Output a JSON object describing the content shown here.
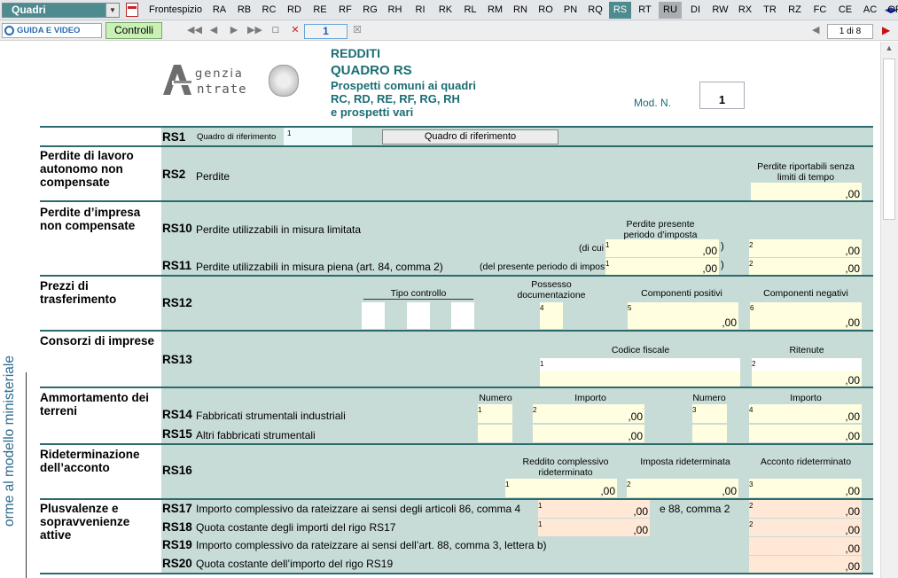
{
  "toolbar": {
    "combo_value": "Quadri",
    "frontespizio": "Frontespizio",
    "tabs": [
      "RA",
      "RB",
      "RC",
      "RD",
      "RE",
      "RF",
      "RG",
      "RH",
      "RI",
      "RK",
      "RL",
      "RM",
      "RN",
      "RO",
      "PN",
      "RQ",
      "RS",
      "RT",
      "RU",
      "DI",
      "RW",
      "RX",
      "TR",
      "RZ",
      "FC",
      "CE",
      "AC",
      "OF"
    ],
    "selected_tab": "RS",
    "guida_label": "GUIDA E VIDEO",
    "controlli_label": "Controlli",
    "page_number": "1",
    "page_of": "1 di 8"
  },
  "sidebar": {
    "vertical_text": "orme al modello ministeriale"
  },
  "header": {
    "agenzia": "genzia",
    "entrate": "ntrate",
    "title1": "REDDITI",
    "title2": "QUADRO RS",
    "subtitle1": "Prospetti comuni ai quadri",
    "subtitle2": "RC, RD, RE, RF, RG, RH",
    "subtitle3": "e prospetti vari",
    "mod_label": "Mod. N.",
    "mod_value": "1"
  },
  "rs1": {
    "code": "RS1",
    "label": "Quadro di riferimento",
    "button": "Quadro di riferimento"
  },
  "perdite_lavoro": {
    "title": "Perdite di lavoro autonomo non compensate",
    "rs2_code": "RS2",
    "rs2_label": "Perdite",
    "col_header": "Perdite riportabili senza limiti di tempo",
    "value": ",00"
  },
  "perdite_impresa": {
    "title": "Perdite d’impresa non compensate",
    "col_header": "Perdite presente periodo d’imposta",
    "rs10_code": "RS10",
    "rs10_label": "Perdite utilizzabili in misura limitata",
    "rs10_dicui": "(di cui",
    "rs11_code": "RS11",
    "rs11_label": "Perdite utilizzabili in misura piena (art. 84, comma 2)",
    "rs11_del": "(del presente periodo di imposta",
    "value": ",00",
    "close": ")"
  },
  "prezzi": {
    "title": "Prezzi di trasferimento",
    "code": "RS12",
    "tipo_controllo": "Tipo controllo",
    "possesso": "Possesso documentazione",
    "comp_pos": "Componenti positivi",
    "comp_neg": "Componenti negativi",
    "value": ",00"
  },
  "consorzi": {
    "title": "Consorzi di imprese",
    "code": "RS13",
    "codice_fiscale": "Codice fiscale",
    "ritenute": "Ritenute",
    "value": ",00"
  },
  "ammortamento": {
    "title": "Ammortamento dei terreni",
    "numero": "Numero",
    "importo": "Importo",
    "rs14_code": "RS14",
    "rs14_label": "Fabbricati strumentali industriali",
    "rs15_code": "RS15",
    "rs15_label": "Altri fabbricati strumentali",
    "value": ",00"
  },
  "rideterminazione": {
    "title": "Rideterminazione dell’acconto",
    "code": "RS16",
    "col1": "Reddito complessivo rideterminato",
    "col2": "Imposta rideterminata",
    "col3": "Acconto rideterminato",
    "value": ",00"
  },
  "plusvalenze": {
    "title": "Plusvalenze e sopravvenienze attive",
    "rs17_code": "RS17",
    "rs17_label": "Importo complessivo da rateizzare ai sensi degli articoli 86, comma 4",
    "rs17_mid": "e 88, comma 2",
    "rs18_code": "RS18",
    "rs18_label": "Quota costante degli importi del rigo RS17",
    "rs19_code": "RS19",
    "rs19_label": "Importo complessivo da rateizzare ai sensi dell’art. 88, comma 3, lettera b)",
    "rs20_code": "RS20",
    "rs20_label": "Quota costante dell’importo del rigo RS19",
    "value": ",00"
  },
  "sup": {
    "n1": "1",
    "n2": "2",
    "n3": "3",
    "n4": "4",
    "n5": "5",
    "n6": "6"
  }
}
